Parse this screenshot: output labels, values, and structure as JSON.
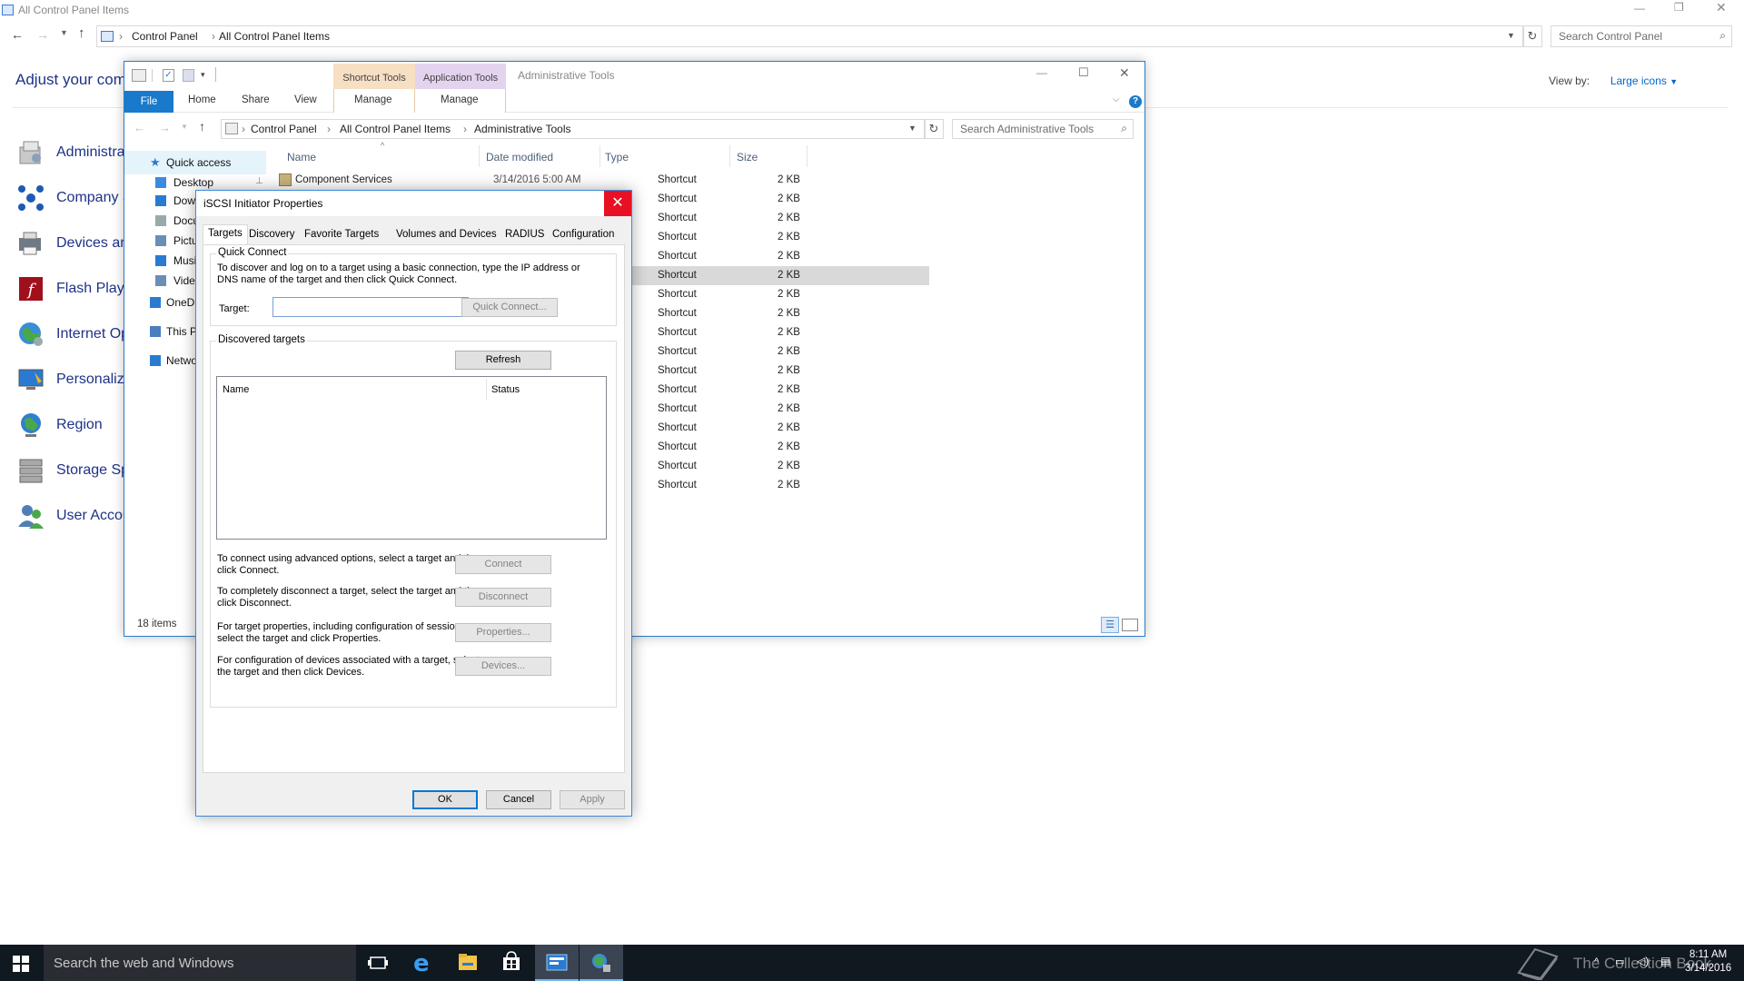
{
  "control_panel": {
    "window_title": "All Control Panel Items",
    "breadcrumb": [
      "Control Panel",
      "All Control Panel Items"
    ],
    "search_placeholder": "Search Control Panel",
    "heading": "Adjust your comp",
    "view_by_label": "View by:",
    "view_by_value": "Large icons",
    "items": [
      {
        "label": "Administra",
        "icon": "administrative-tools-icon"
      },
      {
        "label": "Company S",
        "icon": "company-portal-icon"
      },
      {
        "label": "Devices an",
        "icon": "devices-printers-icon"
      },
      {
        "label": "Flash Playe",
        "icon": "flash-player-icon"
      },
      {
        "label": "Internet Op",
        "icon": "internet-options-icon"
      },
      {
        "label": "Personaliza",
        "icon": "personalization-icon"
      },
      {
        "label": "Region",
        "icon": "region-icon"
      },
      {
        "label": "Storage Sp",
        "icon": "storage-spaces-icon"
      },
      {
        "label": "User Accou",
        "icon": "user-accounts-icon"
      }
    ]
  },
  "explorer": {
    "context_tabs": [
      {
        "label": "Shortcut Tools",
        "color": "#f7dfc3"
      },
      {
        "label": "Application Tools",
        "color": "#e3d3ef"
      }
    ],
    "window_title": "Administrative Tools",
    "ribbon": {
      "file": "File",
      "tabs": [
        "Home",
        "Share",
        "View"
      ],
      "manage_1": "Manage",
      "manage_2": "Manage"
    },
    "breadcrumb": [
      "Control Panel",
      "All Control Panel Items",
      "Administrative Tools"
    ],
    "search_placeholder": "Search Administrative Tools",
    "nav": [
      {
        "label": "Quick access",
        "icon": "star-icon"
      },
      {
        "label": "Desktop",
        "icon": "desktop-icon"
      },
      {
        "label": "Dow",
        "icon": "download-icon"
      },
      {
        "label": "Docu",
        "icon": "document-icon"
      },
      {
        "label": "Pictu",
        "icon": "pictures-icon"
      },
      {
        "label": "Musi",
        "icon": "music-icon"
      },
      {
        "label": "Vide",
        "icon": "videos-icon"
      },
      {
        "label": "OneDr",
        "icon": "onedrive-icon"
      },
      {
        "label": "This P",
        "icon": "this-pc-icon"
      },
      {
        "label": "Netwo",
        "icon": "network-icon"
      }
    ],
    "columns": {
      "name": "Name",
      "date": "Date modified",
      "type": "Type",
      "size": "Size"
    },
    "first_file": {
      "name": "Component Services",
      "date": "3/14/2016 5:00 AM",
      "type": "Shortcut",
      "size": "2 KB"
    },
    "row_type": "Shortcut",
    "row_size": "2 KB",
    "visible_rows": 18,
    "selected_row": 5,
    "status": "18 items"
  },
  "dialog": {
    "title": "iSCSI Initiator Properties",
    "tabs": [
      "Targets",
      "Discovery",
      "Favorite Targets",
      "Volumes and Devices",
      "RADIUS",
      "Configuration"
    ],
    "quick_connect": {
      "group_label": "Quick Connect",
      "description": "To discover and log on to a target using a basic connection, type the IP address or DNS name of the target and then click Quick Connect.",
      "target_label": "Target:",
      "target_value": "",
      "button": "Quick Connect..."
    },
    "discovered": {
      "group_label": "Discovered targets",
      "refresh": "Refresh",
      "col_name": "Name",
      "col_status": "Status"
    },
    "actions": [
      {
        "text": "To connect using advanced options, select a target and then click Connect.",
        "button": "Connect"
      },
      {
        "text": "To completely disconnect a target, select the target and then click Disconnect.",
        "button": "Disconnect"
      },
      {
        "text": "For target properties, including configuration of sessions, select the target and click Properties.",
        "button": "Properties..."
      },
      {
        "text": "For configuration of devices associated with a target, select the target and then click Devices.",
        "button": "Devices..."
      }
    ],
    "ok": "OK",
    "cancel": "Cancel",
    "apply": "Apply"
  },
  "taskbar": {
    "search_placeholder": "Search the web and Windows",
    "watermark": "The Collection Book",
    "time": "8:11 AM",
    "date": "3/14/2016"
  }
}
